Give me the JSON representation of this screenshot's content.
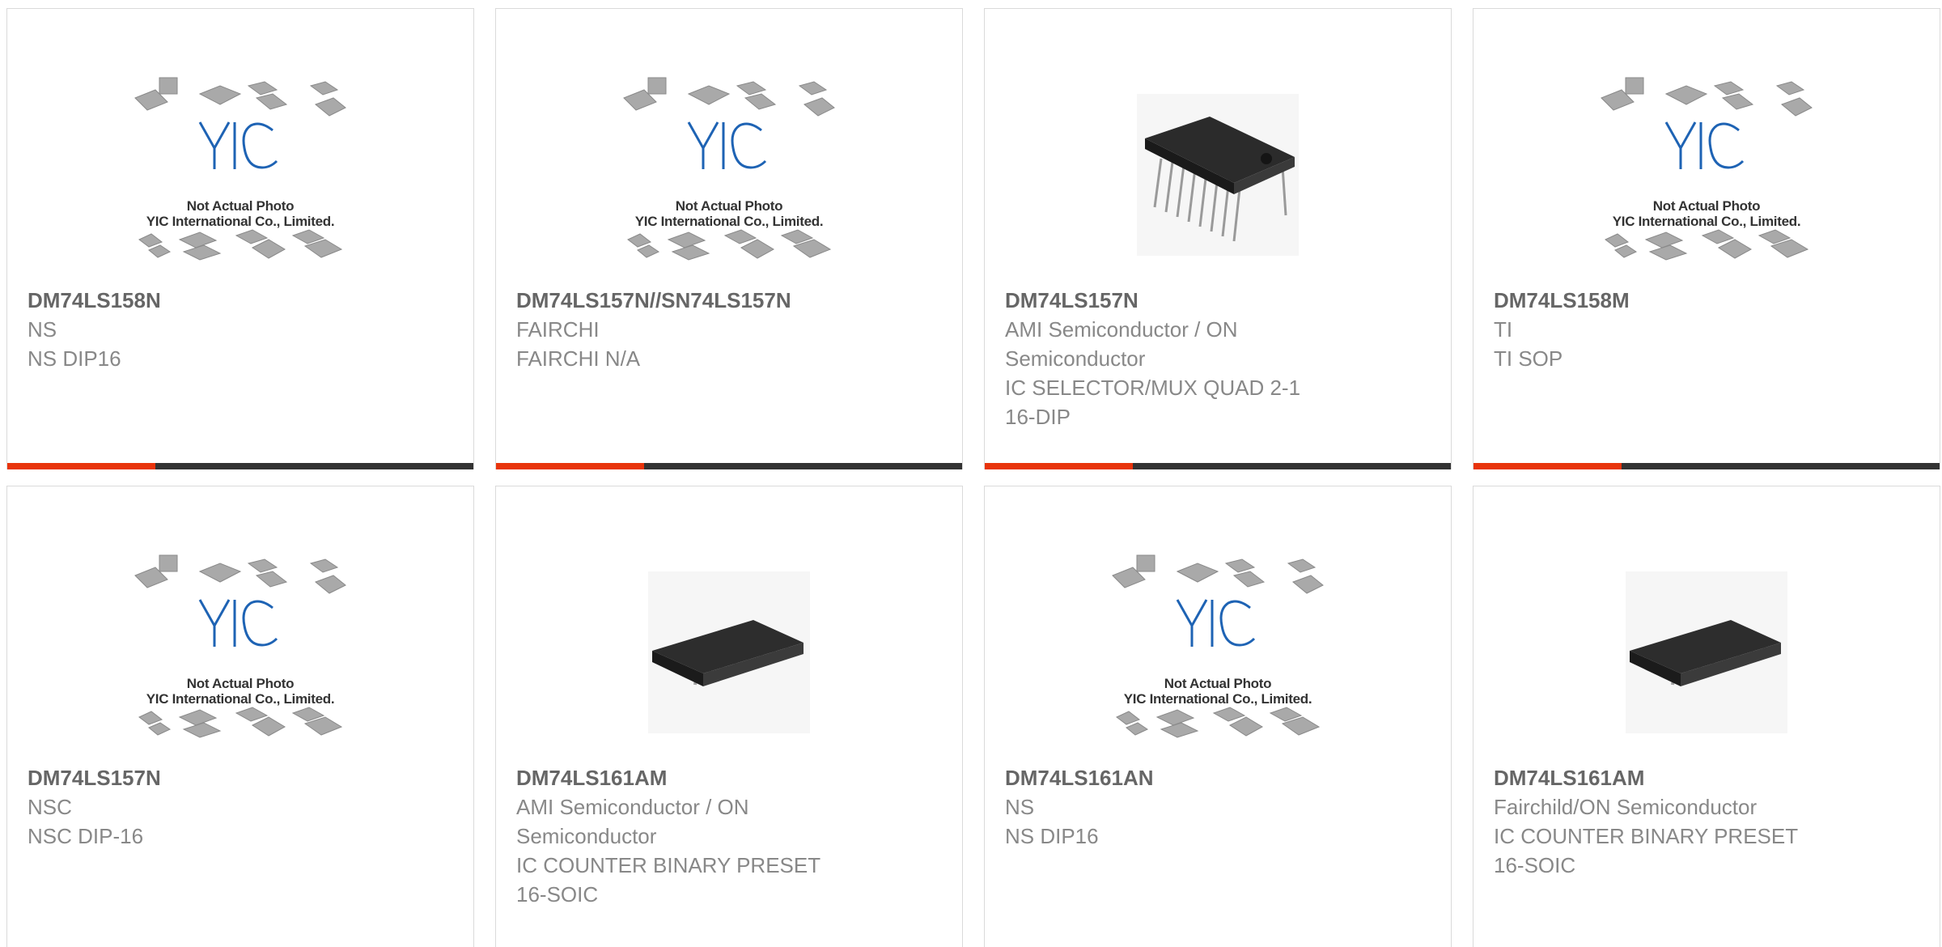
{
  "placeholder": {
    "logo_text": "YIC",
    "caption_line1": "Not Actual Photo",
    "caption_line2": "YIC International Co., Limited."
  },
  "colors": {
    "accent": "#e8340c",
    "bar": "#333333",
    "logo": "#1e63b4"
  },
  "products": [
    {
      "part": "DM74LS158N",
      "lines": [
        "NS",
        "NS DIP16"
      ],
      "image": "placeholder"
    },
    {
      "part": "DM74LS157N//SN74LS157N",
      "lines": [
        "FAIRCHI",
        "FAIRCHI N/A"
      ],
      "image": "placeholder"
    },
    {
      "part": "DM74LS157N",
      "lines": [
        "AMI Semiconductor / ON",
        "Semiconductor",
        "IC SELECTOR/MUX QUAD 2-1",
        "16-DIP"
      ],
      "image": "dip-chip"
    },
    {
      "part": "DM74LS158M",
      "lines": [
        "TI",
        "TI SOP"
      ],
      "image": "placeholder"
    },
    {
      "part": "DM74LS157N",
      "lines": [
        "NSC",
        "NSC DIP-16"
      ],
      "image": "placeholder"
    },
    {
      "part": "DM74LS161AM",
      "lines": [
        "AMI Semiconductor / ON",
        "Semiconductor",
        "IC COUNTER BINARY PRESET",
        "16-SOIC"
      ],
      "image": "soic-chip"
    },
    {
      "part": "DM74LS161AN",
      "lines": [
        "NS",
        "NS DIP16"
      ],
      "image": "placeholder"
    },
    {
      "part": "DM74LS161AM",
      "lines": [
        "Fairchild/ON Semiconductor",
        "IC COUNTER BINARY PRESET",
        "16-SOIC"
      ],
      "image": "soic-chip"
    }
  ]
}
